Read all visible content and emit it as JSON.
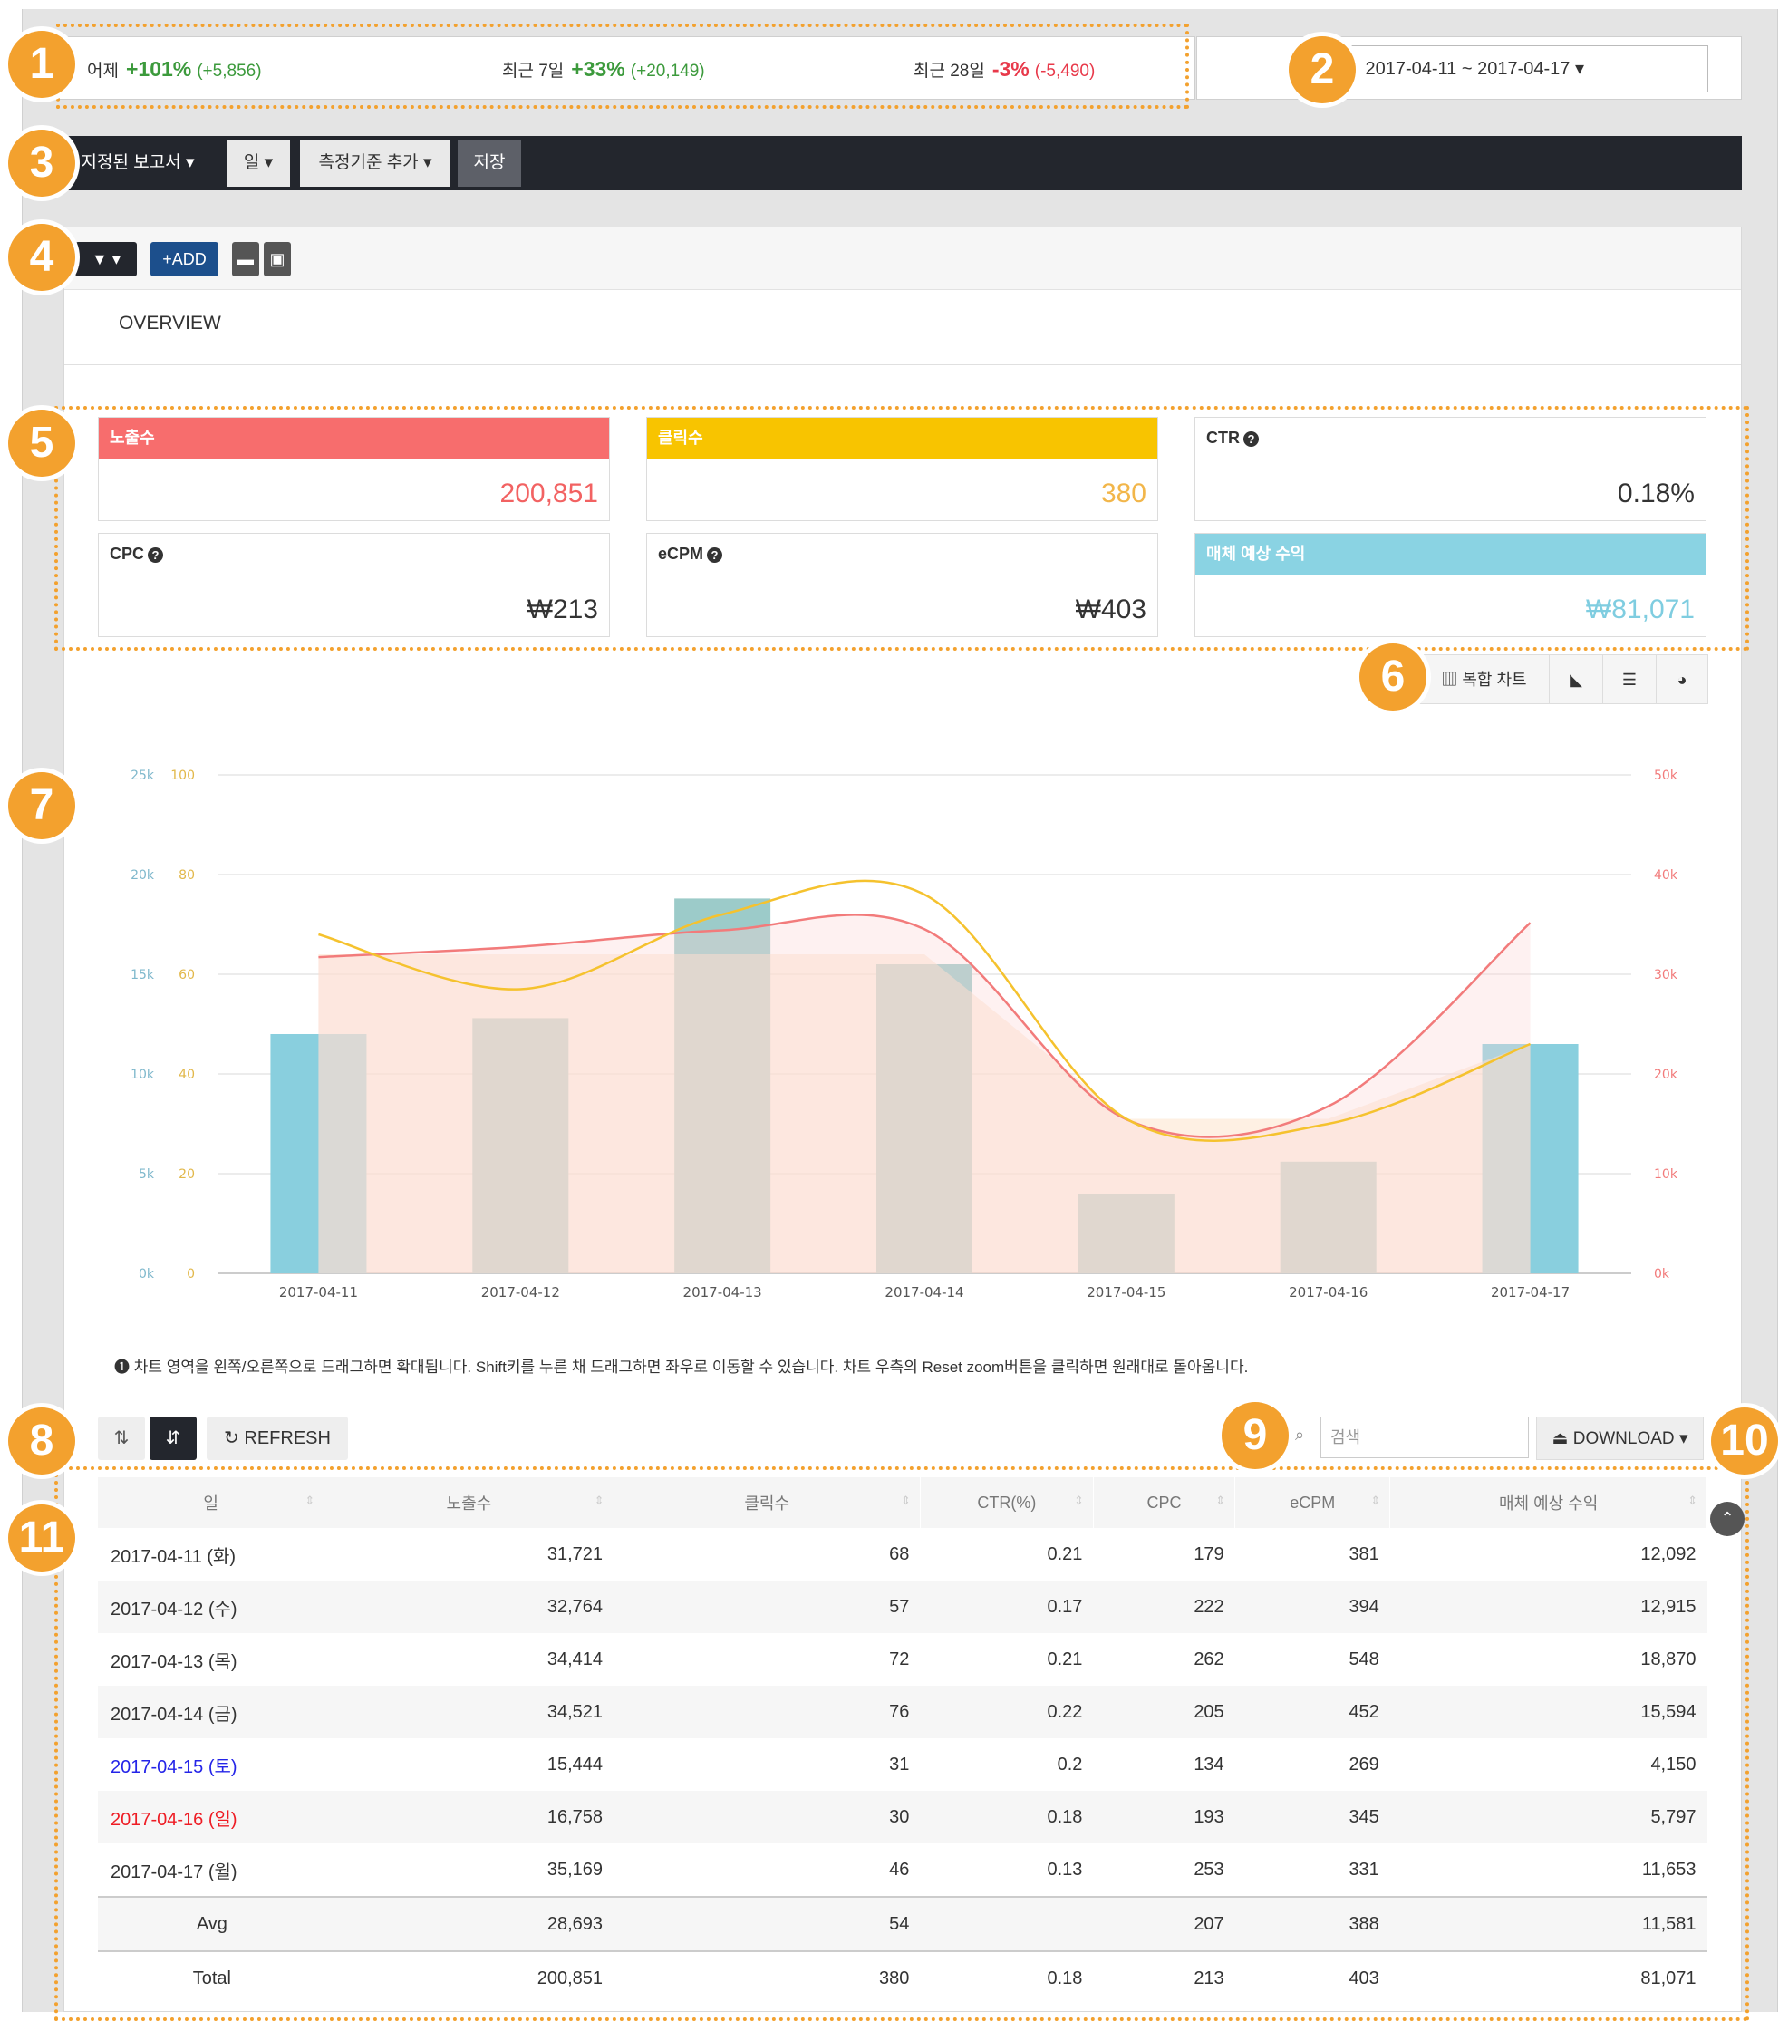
{
  "stats": {
    "yesterday": {
      "label": "어제",
      "pct": "+101%",
      "delta": "(+5,856)"
    },
    "last7": {
      "label": "최근 7일",
      "pct": "+33%",
      "delta": "(+20,149)"
    },
    "last28": {
      "label": "최근 28일",
      "pct": "-3%",
      "delta": "(-5,490)"
    }
  },
  "date_range": "2017-04-11 ~ 2017-04-17",
  "toolbar": {
    "report": "지정된 보고서",
    "unit": "일",
    "add_metric": "측정기준 추가",
    "save": "저장"
  },
  "panel": {
    "add_label": "+ADD",
    "tab": "OVERVIEW"
  },
  "cards": [
    {
      "label": "노출수",
      "value": "200,851"
    },
    {
      "label": "클릭수",
      "value": "380"
    },
    {
      "label": "CTR",
      "value": "0.18%"
    },
    {
      "label": "CPC",
      "value": "₩213"
    },
    {
      "label": "eCPM",
      "value": "₩403"
    },
    {
      "label": "매체 예상 수익",
      "value": "₩81,071"
    }
  ],
  "chart_buttons": {
    "combo": "복합 차트"
  },
  "chart_note": "❶ 차트 영역을 왼쪽/오른쪽으로 드래그하면 확대됩니다. Shift키를 누른 채 드래그하면 좌우로 이동할 수 있습니다. 차트 우측의 Reset zoom버튼을 클릭하면 원래대로 돌아옵니다.",
  "chart_data": {
    "type": "bar",
    "categories": [
      "2017-04-11",
      "2017-04-12",
      "2017-04-13",
      "2017-04-14",
      "2017-04-15",
      "2017-04-16",
      "2017-04-17"
    ],
    "y_left1_ticks": [
      "0k",
      "5k",
      "10k",
      "15k",
      "20k",
      "25k"
    ],
    "y_left2_ticks": [
      "0",
      "20",
      "40",
      "60",
      "80",
      "100"
    ],
    "y_right_ticks": [
      "0k",
      "10k",
      "20k",
      "30k",
      "40k",
      "50k"
    ],
    "series": [
      {
        "type": "bar",
        "axis": "left1",
        "values": [
          12000,
          12800,
          18800,
          15500,
          4000,
          5600,
          11500
        ]
      },
      {
        "type": "area",
        "axis": "left2",
        "values": [
          64,
          64,
          64,
          64,
          31,
          31,
          46
        ]
      },
      {
        "type": "line",
        "axis": "left2",
        "values": [
          68,
          57,
          72,
          76,
          31,
          30,
          46
        ]
      },
      {
        "type": "line",
        "axis": "right",
        "values": [
          31721,
          32764,
          34414,
          34521,
          15444,
          16758,
          35169
        ]
      }
    ],
    "colors": {
      "bar": "#89cfde",
      "bar_overlap": "#9ccbc9",
      "area": "#fde4cc",
      "yellow": "#f5c22e",
      "red": "#f27b7b"
    },
    "ylim_left1": [
      0,
      25000
    ],
    "ylim_left2": [
      0,
      100
    ],
    "ylim_right": [
      0,
      50000
    ]
  },
  "table_controls": {
    "refresh": "REFRESH",
    "search_placeholder": "검색",
    "download": "DOWNLOAD"
  },
  "table": {
    "headers": [
      "일",
      "노출수",
      "클릭수",
      "CTR(%)",
      "CPC",
      "eCPM",
      "매체 예상 수익"
    ],
    "rows": [
      [
        "2017-04-11 (화)",
        "31,721",
        "68",
        "0.21",
        "179",
        "381",
        "12,092"
      ],
      [
        "2017-04-12 (수)",
        "32,764",
        "57",
        "0.17",
        "222",
        "394",
        "12,915"
      ],
      [
        "2017-04-13 (목)",
        "34,414",
        "72",
        "0.21",
        "262",
        "548",
        "18,870"
      ],
      [
        "2017-04-14 (금)",
        "34,521",
        "76",
        "0.22",
        "205",
        "452",
        "15,594"
      ],
      [
        "2017-04-15 (토)",
        "15,444",
        "31",
        "0.2",
        "134",
        "269",
        "4,150"
      ],
      [
        "2017-04-16 (일)",
        "16,758",
        "30",
        "0.18",
        "193",
        "345",
        "5,797"
      ],
      [
        "2017-04-17 (월)",
        "35,169",
        "46",
        "0.13",
        "253",
        "331",
        "11,653"
      ]
    ],
    "avg": [
      "Avg",
      "28,693",
      "54",
      "",
      "207",
      "388",
      "11,581"
    ],
    "total": [
      "Total",
      "200,851",
      "380",
      "0.18",
      "213",
      "403",
      "81,071"
    ]
  },
  "callouts": [
    "1",
    "2",
    "3",
    "4",
    "5",
    "6",
    "7",
    "8",
    "9",
    "10",
    "11"
  ]
}
